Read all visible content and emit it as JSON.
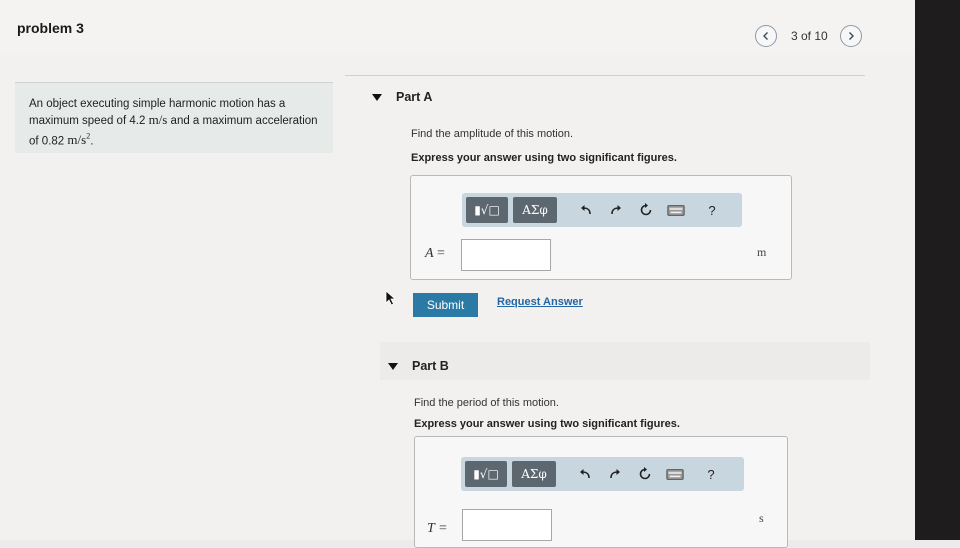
{
  "header": {
    "title": "problem 3",
    "page_indicator": "3 of 10",
    "prev_icon": "chevron-left-icon",
    "next_icon": "chevron-right-icon"
  },
  "problem": {
    "text_1": "An object executing simple harmonic motion has a maximum speed of ",
    "speed_value": "4.2",
    "speed_unit": "m/s",
    "text_2": " and a maximum acceleration of ",
    "accel_value": "0.82",
    "accel_unit": "m/s",
    "accel_exp": "2",
    "text_3": "."
  },
  "toolbar": {
    "template_label": "▮√□",
    "symbols_label": "ΑΣφ",
    "undo_icon": "undo-icon",
    "redo_icon": "redo-icon",
    "reset_icon": "reset-icon",
    "keyboard_icon": "keyboard-icon",
    "help_label": "?"
  },
  "part_a": {
    "label": "Part A",
    "prompt": "Find the amplitude of this motion.",
    "instruction": "Express your answer using two significant figures.",
    "variable": "A",
    "equals": "=",
    "value": "",
    "unit": "m",
    "submit_label": "Submit",
    "request_label": "Request Answer"
  },
  "part_b": {
    "label": "Part B",
    "prompt": "Find the period of this motion.",
    "instruction": "Express your answer using two significant figures.",
    "variable": "T",
    "equals": "=",
    "value": "",
    "unit": "s"
  }
}
